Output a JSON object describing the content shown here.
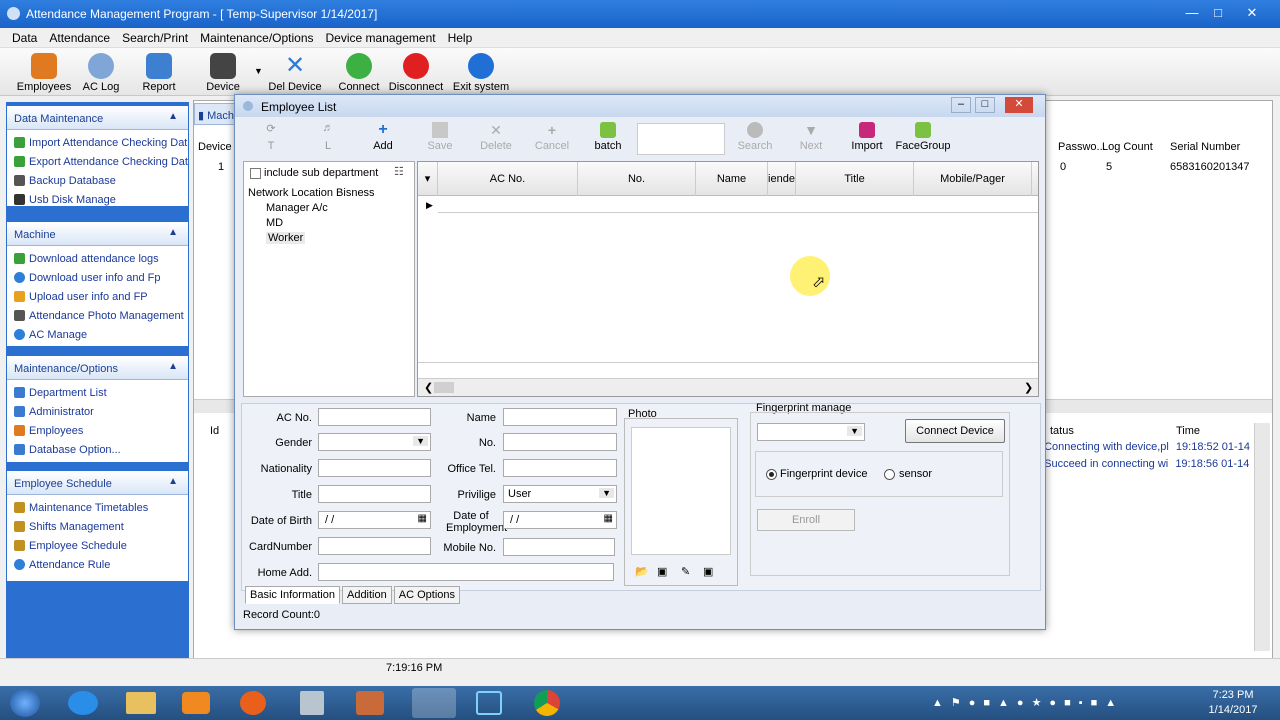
{
  "app": {
    "title": "Attendance Management Program - [ Temp-Supervisor 1/14/2017]"
  },
  "menu": [
    "Data",
    "Attendance",
    "Search/Print",
    "Maintenance/Options",
    "Device management",
    "Help"
  ],
  "toolbar": [
    {
      "label": "Employees",
      "icon": "employees-icon",
      "color": "#e07a20"
    },
    {
      "label": "AC Log",
      "icon": "clock-icon",
      "color": "#7fa6d6"
    },
    {
      "label": "Report",
      "icon": "report-icon",
      "color": "#3d7fd1"
    },
    {
      "label": "Device",
      "icon": "device-icon",
      "color": "#444444"
    },
    {
      "label": "Del Device",
      "icon": "delete-device-icon",
      "color": "#2e79d8"
    },
    {
      "label": "Connect",
      "icon": "connect-icon",
      "color": "#3cb043"
    },
    {
      "label": "Disconnect",
      "icon": "disconnect-icon",
      "color": "#e02020"
    },
    {
      "label": "Exit system",
      "icon": "power-icon",
      "color": "#1f6fd6"
    }
  ],
  "sidebar": [
    {
      "title": "Data Maintenance",
      "items": [
        {
          "label": "Import Attendance Checking Data",
          "icon": "import-icon",
          "color": "#3aa03a"
        },
        {
          "label": "Export Attendance Checking Data",
          "icon": "export-icon",
          "color": "#3aa03a"
        },
        {
          "label": "Backup Database",
          "icon": "backup-icon",
          "color": "#555555"
        },
        {
          "label": "Usb Disk Manage",
          "icon": "usb-icon",
          "color": "#333333"
        }
      ]
    },
    {
      "title": "Machine",
      "items": [
        {
          "label": "Download attendance logs",
          "icon": "download-icon",
          "color": "#3aa03a"
        },
        {
          "label": "Download user info and Fp",
          "icon": "download-user-icon",
          "color": "#2e7fd8"
        },
        {
          "label": "Upload user info and FP",
          "icon": "upload-icon",
          "color": "#e8a020"
        },
        {
          "label": "Attendance Photo Management",
          "icon": "photo-icon",
          "color": "#555555"
        },
        {
          "label": "AC Manage",
          "icon": "ac-manage-icon",
          "color": "#2e7fd8"
        }
      ]
    },
    {
      "title": "Maintenance/Options",
      "items": [
        {
          "label": "Department List",
          "icon": "department-icon",
          "color": "#3a7bd0"
        },
        {
          "label": "Administrator",
          "icon": "admin-icon",
          "color": "#3a7bd0"
        },
        {
          "label": "Employees",
          "icon": "employees-small-icon",
          "color": "#e07a20"
        },
        {
          "label": "Database Option...",
          "icon": "database-icon",
          "color": "#3a7bd0"
        }
      ]
    },
    {
      "title": "Employee Schedule",
      "items": [
        {
          "label": "Maintenance Timetables",
          "icon": "timetable-icon",
          "color": "#c09020"
        },
        {
          "label": "Shifts Management",
          "icon": "shifts-icon",
          "color": "#c09020"
        },
        {
          "label": "Employee Schedule",
          "icon": "schedule-icon",
          "color": "#c09020"
        },
        {
          "label": "Attendance Rule",
          "icon": "rule-icon",
          "color": "#2e7fd8"
        }
      ]
    }
  ],
  "bg": {
    "tab": "Mach",
    "device_col": "Device",
    "device_val": "1",
    "cols": [
      "Passwo...",
      "Log Count",
      "Serial Number"
    ],
    "row": [
      "0",
      "5",
      "6583160201347"
    ],
    "log_cols": [
      "Id",
      "tatus",
      "Time"
    ],
    "logs": [
      [
        "] Connecting with device,pl",
        "19:18:52 01-14"
      ],
      [
        "] Succeed in connecting wi",
        "19:18:56 01-14"
      ]
    ]
  },
  "dialog": {
    "title": "Employee List",
    "buttons": [
      {
        "label": "T",
        "icon": "refresh-icon",
        "enabled": false
      },
      {
        "label": "L",
        "icon": "filter-icon",
        "enabled": false
      },
      {
        "label": "Add",
        "icon": "add-icon",
        "enabled": true
      },
      {
        "label": "Save",
        "icon": "save-icon",
        "enabled": false
      },
      {
        "label": "Delete",
        "icon": "delete-icon",
        "enabled": false
      },
      {
        "label": "Cancel",
        "icon": "cancel-icon",
        "enabled": false
      },
      {
        "label": "batch",
        "icon": "batch-icon",
        "enabled": true
      },
      {
        "label": "Search",
        "icon": "search-icon",
        "enabled": false
      },
      {
        "label": "Next",
        "icon": "next-icon",
        "enabled": false
      },
      {
        "label": "Import",
        "icon": "import-dlg-icon",
        "enabled": true
      },
      {
        "label": "FaceGroup",
        "icon": "facegroup-icon",
        "enabled": true
      }
    ],
    "include_sub": "include sub department",
    "tree": {
      "root": "Network Location Bisness",
      "children": [
        "Manager A/c",
        "MD",
        "Worker"
      ]
    },
    "grid_cols": [
      "AC No.",
      "No.",
      "Name",
      "iende",
      "Title",
      "Mobile/Pager"
    ],
    "form": {
      "ac_no": "AC No.",
      "gender": "Gender",
      "nationality": "Nationality",
      "title": "Title",
      "dob": "Date of Birth",
      "dob_val": " /  /",
      "card": "CardNumber",
      "home": "Home Add.",
      "name": "Name",
      "no": "No.",
      "office": "Office Tel.",
      "privilige": "Privilige",
      "privilige_val": "User",
      "doe": "Date of Employment",
      "doe_val": " /  /",
      "mobile": "Mobile No.",
      "photo": "Photo",
      "fp_manage": "Fingerprint manage",
      "connect": "Connect Device",
      "fp_device": "Fingerprint device",
      "sensor": "sensor",
      "enroll": "Enroll"
    },
    "tabs": [
      "Basic Information",
      "Addition",
      "AC Options"
    ],
    "record_count": "Record Count:0"
  },
  "status": {
    "time": "7:19:16 PM"
  },
  "taskbar": {
    "time": "7:23 PM",
    "date": "1/14/2017"
  }
}
